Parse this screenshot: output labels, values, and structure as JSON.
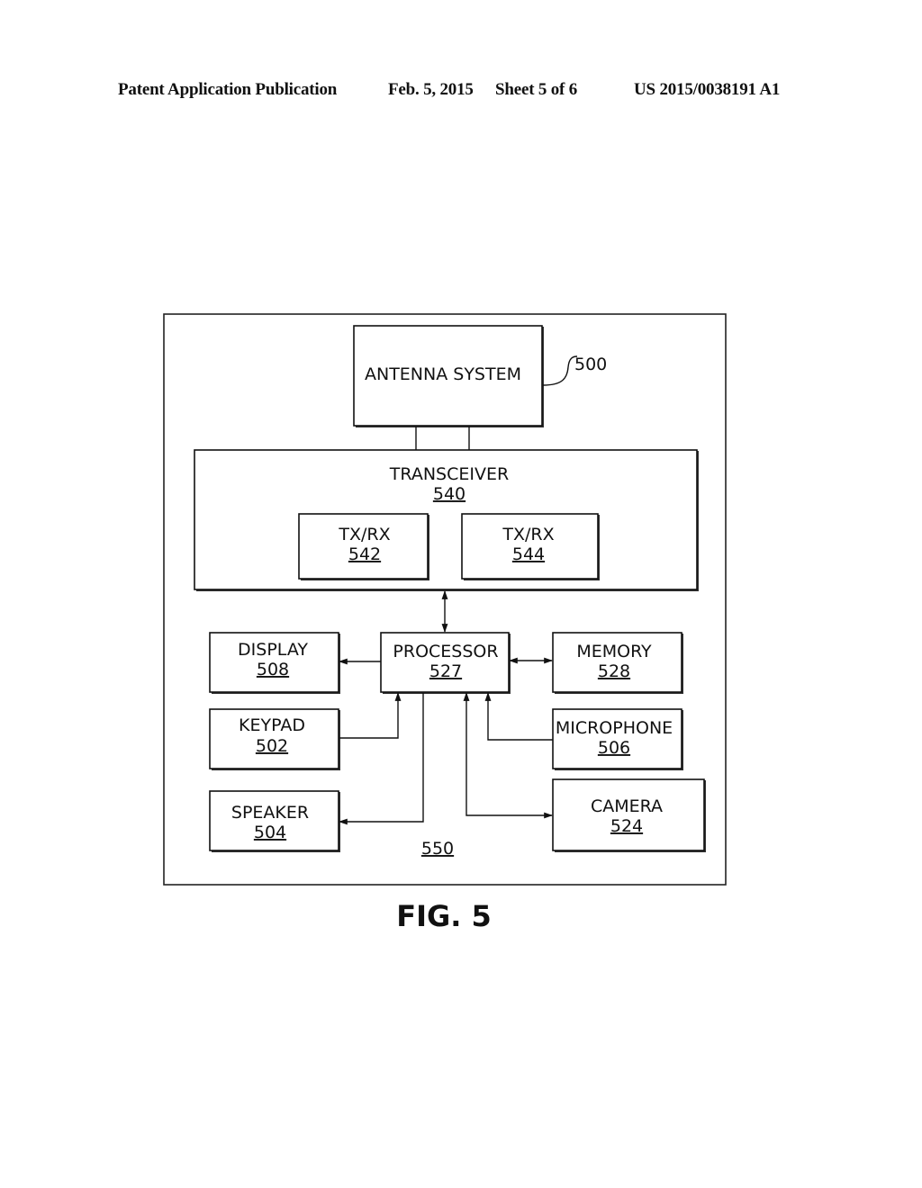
{
  "header": {
    "publication": "Patent Application Publication",
    "date": "Feb. 5, 2015",
    "sheet": "Sheet 5 of 6",
    "number": "US 2015/0038191 A1"
  },
  "figure": {
    "caption": "FIG. 5",
    "reference_label": "500",
    "container_number": "550"
  },
  "blocks": {
    "antenna": {
      "label": "ANTENNA SYSTEM"
    },
    "transceiver": {
      "label": "TRANSCEIVER",
      "number": "540"
    },
    "txrx1": {
      "label": "TX/RX",
      "number": "542"
    },
    "txrx2": {
      "label": "TX/RX",
      "number": "544"
    },
    "display": {
      "label": "DISPLAY",
      "number": "508"
    },
    "processor": {
      "label": "PROCESSOR",
      "number": "527"
    },
    "memory": {
      "label": "MEMORY",
      "number": "528"
    },
    "keypad": {
      "label": "KEYPAD",
      "number": "502"
    },
    "microphone": {
      "label": "MICROPHONE",
      "number": "506"
    },
    "speaker": {
      "label": "SPEAKER",
      "number": "504"
    },
    "camera": {
      "label": "CAMERA",
      "number": "524"
    }
  },
  "connections": [
    {
      "from": "antenna",
      "to": "transceiver",
      "type": "line"
    },
    {
      "from": "transceiver",
      "to": "processor",
      "type": "bidirectional"
    },
    {
      "from": "processor",
      "to": "display",
      "type": "arrow"
    },
    {
      "from": "processor",
      "to": "memory",
      "type": "bidirectional"
    },
    {
      "from": "keypad",
      "to": "processor",
      "type": "arrow"
    },
    {
      "from": "microphone",
      "to": "processor",
      "type": "arrow"
    },
    {
      "from": "processor",
      "to": "speaker",
      "type": "arrow"
    },
    {
      "from": "processor",
      "to": "camera",
      "type": "bidirectional"
    }
  ]
}
